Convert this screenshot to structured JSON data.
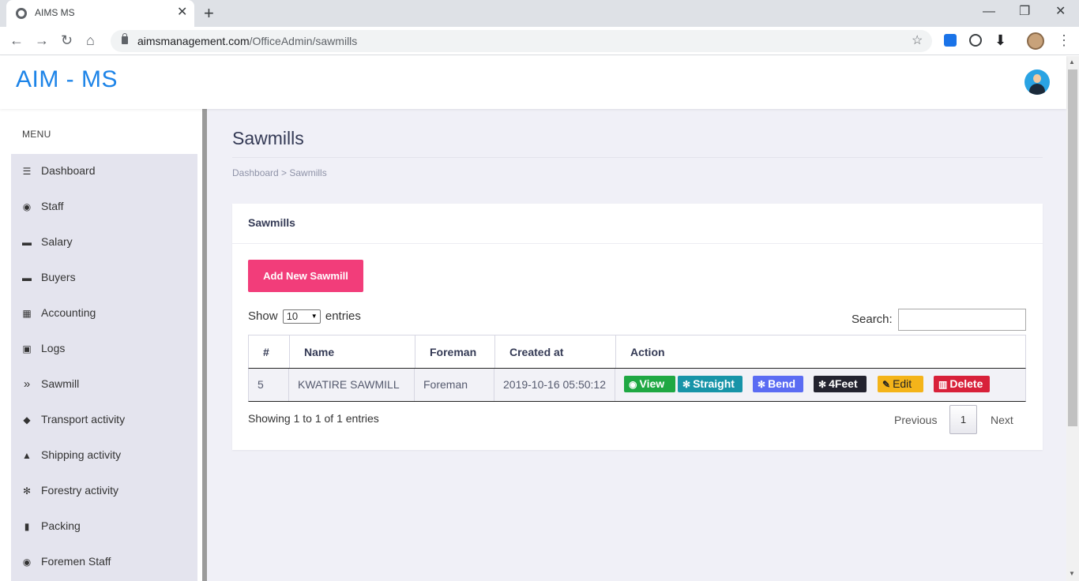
{
  "browser": {
    "tab_title": "AIMS MS",
    "tab_close": "✕",
    "new_tab": "+",
    "url_host": "aimsmanagement.com",
    "url_path": "/OfficeAdmin/sawmills",
    "minimize": "—",
    "restore": "❐",
    "close": "✕"
  },
  "app": {
    "logo": "AIM - MS"
  },
  "sidebar": {
    "menu_label": "MENU",
    "items": [
      {
        "label": "Dashboard",
        "icon": "menu-icon",
        "glyph": "☰"
      },
      {
        "label": "Staff",
        "icon": "user-icon",
        "glyph": "◉"
      },
      {
        "label": "Salary",
        "icon": "money-icon",
        "glyph": "▬"
      },
      {
        "label": "Buyers",
        "icon": "money-icon",
        "glyph": "▬"
      },
      {
        "label": "Accounting",
        "icon": "calendar-icon",
        "glyph": "▦"
      },
      {
        "label": "Logs",
        "icon": "image-icon",
        "glyph": "▣"
      },
      {
        "label": "Sawmill",
        "icon": "double-chevron-icon",
        "glyph": "»"
      },
      {
        "label": "Transport activity",
        "icon": "car-icon",
        "glyph": "◆"
      },
      {
        "label": "Shipping activity",
        "icon": "ship-icon",
        "glyph": "▲"
      },
      {
        "label": "Forestry activity",
        "icon": "snowflake-icon",
        "glyph": "✻"
      },
      {
        "label": "Packing",
        "icon": "suitcase-icon",
        "glyph": "▮"
      },
      {
        "label": "Foremen Staff",
        "icon": "user-icon",
        "glyph": "◉"
      }
    ]
  },
  "page": {
    "title": "Sawmills",
    "breadcrumb": "Dashboard > Sawmills"
  },
  "card": {
    "title": "Sawmills",
    "add_button": "Add New Sawmill",
    "show_label": "Show",
    "show_value": "10",
    "entries_label": "entries",
    "search_label": "Search:",
    "search_value": "",
    "columns": [
      "#",
      "Name",
      "Foreman",
      "Created at",
      "Action"
    ],
    "rows": [
      {
        "id": "5",
        "name": "KWATIRE SAWMILL",
        "foreman": "Foreman",
        "created_at": "2019-10-16 05:50:12"
      }
    ],
    "actions": [
      {
        "label": "View",
        "icon": "eye-icon",
        "glyph": "◉",
        "color": "#1fa843"
      },
      {
        "label": "Straight",
        "icon": "gear-icon",
        "glyph": "✻",
        "color": "#1794a8"
      },
      {
        "label": "Bend",
        "icon": "gear-icon",
        "glyph": "✻",
        "color": "#5b6cf3"
      },
      {
        "label": "4Feet",
        "icon": "gear-icon",
        "glyph": "✻",
        "color": "#23232f"
      },
      {
        "label": "Edit",
        "icon": "edit-icon",
        "glyph": "✎",
        "color": "#f4b41a"
      },
      {
        "label": "Delete",
        "icon": "trash-icon",
        "glyph": "▥",
        "color": "#d8213a"
      }
    ],
    "info": "Showing 1 to 1 of 1 entries",
    "pagination": {
      "previous": "Previous",
      "current": "1",
      "next": "Next"
    }
  },
  "colors": {
    "brand": "#1d84e8",
    "add_button": "#f23d7a",
    "content_bg": "#f0f0f7",
    "menu_bg": "#e4e4ee"
  }
}
